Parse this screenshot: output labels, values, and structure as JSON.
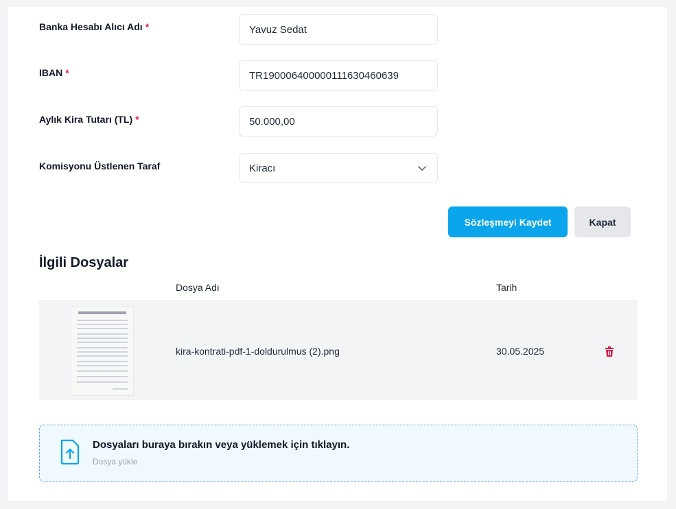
{
  "form": {
    "recipient_label": "Banka Hesabı Alıcı Adı",
    "recipient_value": "Yavuz Sedat",
    "iban_label": "IBAN",
    "iban_value": "TR190006400000111630460639",
    "rent_label": "Aylık Kira Tutarı (TL)",
    "rent_value": "50.000,00",
    "commission_label": "Komisyonu Üstlenen Taraf",
    "commission_selected": "Kiracı",
    "required_mark": "*"
  },
  "actions": {
    "save_label": "Sözleşmeyi Kaydet",
    "close_label": "Kapat"
  },
  "files": {
    "title": "İlgili Dosyalar",
    "columns": [
      "Dosya Adı",
      "Tarih"
    ],
    "rows": [
      {
        "name": "kira-kontrati-pdf-1-doldurulmus (2).png",
        "date": "30.05.2025"
      }
    ]
  },
  "upload": {
    "title": "Dosyaları buraya bırakın veya yüklemek için tıklayın.",
    "subtitle": "Dosya yükle"
  },
  "colors": {
    "primary": "#0ba5ec",
    "danger": "#e11d48",
    "drop_border": "#60a5fa"
  },
  "icons": {
    "select": "chevron-down-icon",
    "delete": "trash-icon",
    "upload": "file-upload-icon"
  }
}
